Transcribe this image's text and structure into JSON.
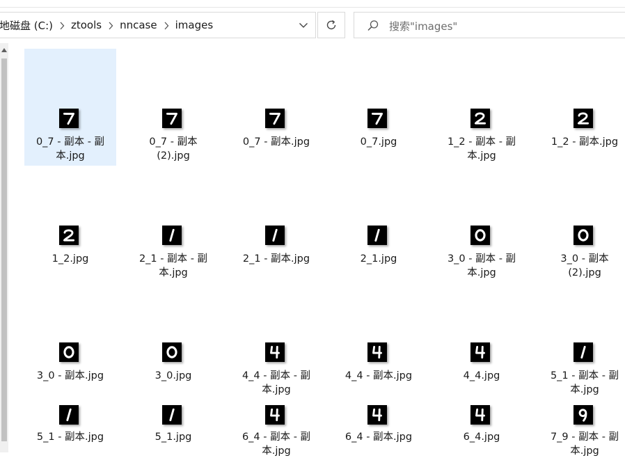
{
  "address_bar": {
    "breadcrumbs": [
      "本地磁盘 (C:)",
      "ztools",
      "nncase",
      "images"
    ]
  },
  "search": {
    "placeholder": "搜索\"images\""
  },
  "files": [
    {
      "name": "0_7 - 副本 - 副本.jpg",
      "line1": "0_7 - 副本 - 副",
      "line2": "本.jpg",
      "digit": "7",
      "selected": true
    },
    {
      "name": "0_7 - 副本 (2).jpg",
      "line1": "0_7 - 副本",
      "line2": "(2).jpg",
      "digit": "7",
      "selected": false
    },
    {
      "name": "0_7 - 副本.jpg",
      "line1": "0_7 - 副本.jpg",
      "line2": "",
      "digit": "7",
      "selected": false
    },
    {
      "name": "0_7.jpg",
      "line1": "0_7.jpg",
      "line2": "",
      "digit": "7",
      "selected": false
    },
    {
      "name": "1_2 - 副本 - 副本.jpg",
      "line1": "1_2 - 副本 - 副",
      "line2": "本.jpg",
      "digit": "2",
      "selected": false
    },
    {
      "name": "1_2 - 副本.jpg",
      "line1": "1_2 - 副本.jpg",
      "line2": "",
      "digit": "2",
      "selected": false
    },
    {
      "name": "1_2.jpg",
      "line1": "1_2.jpg",
      "line2": "",
      "digit": "2",
      "selected": false
    },
    {
      "name": "2_1 - 副本 - 副本.jpg",
      "line1": "2_1 - 副本 - 副",
      "line2": "本.jpg",
      "digit": "1",
      "selected": false
    },
    {
      "name": "2_1 - 副本.jpg",
      "line1": "2_1 - 副本.jpg",
      "line2": "",
      "digit": "1",
      "selected": false
    },
    {
      "name": "2_1.jpg",
      "line1": "2_1.jpg",
      "line2": "",
      "digit": "1",
      "selected": false
    },
    {
      "name": "3_0 - 副本 - 副本.jpg",
      "line1": "3_0 - 副本 - 副",
      "line2": "本.jpg",
      "digit": "0",
      "selected": false
    },
    {
      "name": "3_0 - 副本 (2).jpg",
      "line1": "3_0 - 副本",
      "line2": "(2).jpg",
      "digit": "0",
      "selected": false
    },
    {
      "name": "3_0 - 副本.jpg",
      "line1": "3_0 - 副本.jpg",
      "line2": "",
      "digit": "0",
      "selected": false
    },
    {
      "name": "3_0.jpg",
      "line1": "3_0.jpg",
      "line2": "",
      "digit": "0",
      "selected": false
    },
    {
      "name": "4_4 - 副本 - 副本.jpg",
      "line1": "4_4 - 副本 - 副",
      "line2": "本.jpg",
      "digit": "4",
      "selected": false
    },
    {
      "name": "4_4 - 副本.jpg",
      "line1": "4_4 - 副本.jpg",
      "line2": "",
      "digit": "4",
      "selected": false
    },
    {
      "name": "4_4.jpg",
      "line1": "4_4.jpg",
      "line2": "",
      "digit": "4",
      "selected": false
    },
    {
      "name": "5_1 - 副本 - 副本.jpg",
      "line1": "5_1 - 副本 - 副",
      "line2": "本.jpg",
      "digit": "1",
      "selected": false
    },
    {
      "name": "5_1 - 副本.jpg",
      "line1": "5_1 - 副本.jpg",
      "line2": "",
      "digit": "1",
      "selected": false
    },
    {
      "name": "5_1.jpg",
      "line1": "5_1.jpg",
      "line2": "",
      "digit": "1",
      "selected": false
    },
    {
      "name": "6_4 - 副本 - 副本.jpg",
      "line1": "6_4 - 副本 - 副",
      "line2": "本.jpg",
      "digit": "4",
      "selected": false
    },
    {
      "name": "6_4 - 副本.jpg",
      "line1": "6_4 - 副本.jpg",
      "line2": "",
      "digit": "4",
      "selected": false
    },
    {
      "name": "6_4.jpg",
      "line1": "6_4.jpg",
      "line2": "",
      "digit": "4",
      "selected": false
    },
    {
      "name": "7_9 - 副本 - 副本.jpg",
      "line1": "7_9 - 副本 - 副",
      "line2": "本.jpg",
      "digit": "9",
      "selected": false
    }
  ],
  "colors": {
    "selection": "#e3f0fd",
    "border": "#d9d9d9",
    "scrollbar_thumb": "#c1c1c1"
  },
  "icons": {
    "dropdown": "chevron-down-icon",
    "refresh": "refresh-icon",
    "search": "search-icon",
    "breadcrumb_separator": "chevron-right-icon",
    "scroll_up": "triangle-up-icon"
  }
}
